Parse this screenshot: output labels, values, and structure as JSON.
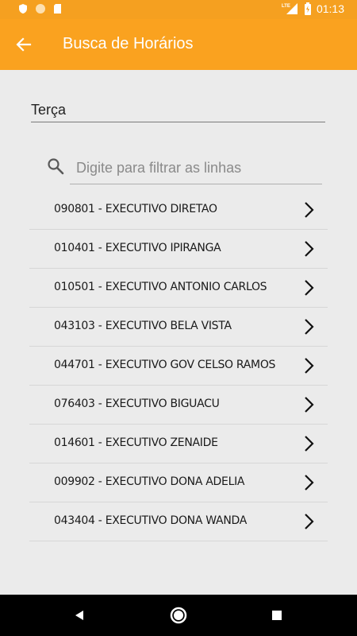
{
  "status_bar": {
    "time": "01:13",
    "network_label": "LTE",
    "icons": [
      "shield-icon",
      "circle-icon",
      "sd-card-icon",
      "signal-icon",
      "battery-icon"
    ]
  },
  "app_bar": {
    "title": "Busca de Horários",
    "back_icon": "arrow-left-icon",
    "background": "#faa21f"
  },
  "day_selector": {
    "value": "Terça"
  },
  "search": {
    "placeholder": "Digite para filtrar as linhas",
    "value": "",
    "icon": "search-icon"
  },
  "lines": [
    {
      "label": "090801 - EXECUTIVO DIRETAO"
    },
    {
      "label": "010401 - EXECUTIVO IPIRANGA"
    },
    {
      "label": "010501 - EXECUTIVO ANTONIO CARLOS"
    },
    {
      "label": "043103 - EXECUTIVO BELA VISTA"
    },
    {
      "label": "044701 - EXECUTIVO GOV CELSO RAMOS"
    },
    {
      "label": "076403 - EXECUTIVO BIGUACU"
    },
    {
      "label": "014601 - EXECUTIVO ZENAIDE"
    },
    {
      "label": "009902 - EXECUTIVO DONA ADELIA"
    },
    {
      "label": "043404 - EXECUTIVO DONA WANDA"
    }
  ],
  "nav_bar": {
    "icons": [
      "back-triangle-icon",
      "home-circle-icon",
      "recents-square-icon"
    ]
  }
}
